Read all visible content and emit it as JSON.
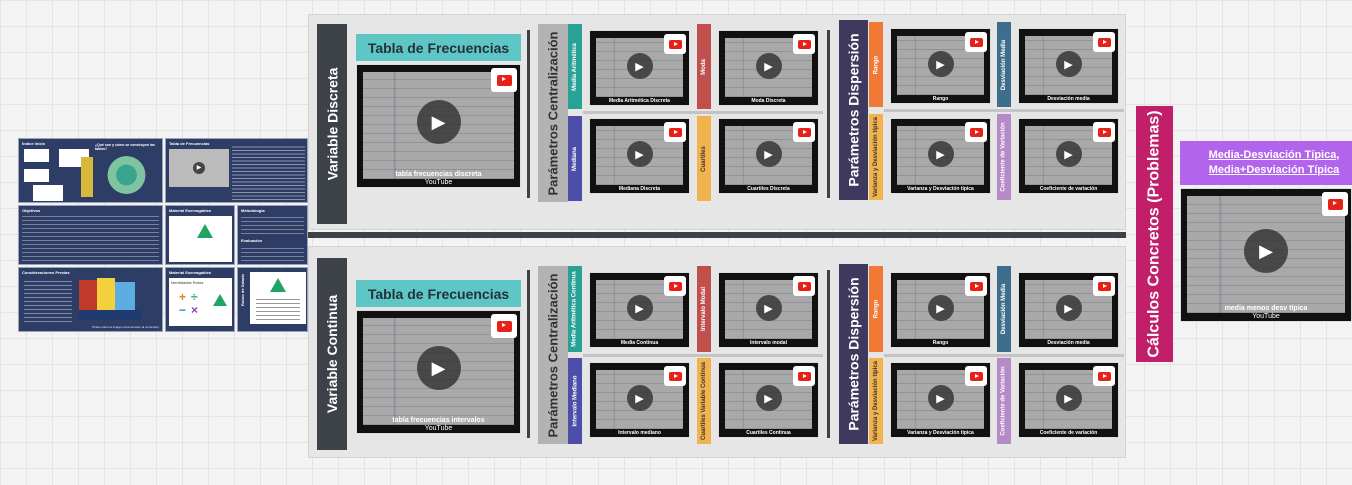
{
  "cards": {
    "intro_title": "Índice Inicio",
    "question_title": "¿Qué son y cómo se construyen las tablas?",
    "tabla_title": "Tabla de Frecuencias",
    "objetivos_title": "Objetivos",
    "material1_title": "Material Eservagables",
    "metodologia_title": "Metodología",
    "consideraciones_title": "Consideraciones Previas",
    "material2_title": "Material Eservagables",
    "evaluacion_title": "Evaluación",
    "identidades_label": "Identidades Rotos",
    "rubric_label": "Rubro de Salario",
    "footer_note": "(Pulse sobre la imagen para acceder al contenido)"
  },
  "discreta": {
    "section_label": "Variable Discreta",
    "tabla_title": "Tabla de Frecuencias",
    "tabla_video_caption": "tabla frecuencias discreta",
    "tabla_video_source": "YouTube",
    "centralizacion_label": "Parámetros Centralización",
    "dispersion_label": "Parámetros Dispersión",
    "tiles": [
      {
        "label": "Media Aritmética",
        "color": "#2aa196",
        "caption": "Media Aritmética Discreta"
      },
      {
        "label": "Moda",
        "color": "#c0504d",
        "caption": "Moda Discreta"
      },
      {
        "label": "Mediana",
        "color": "#4d4ea8",
        "caption": "Mediana Discreta"
      },
      {
        "label": "Cuartiles",
        "color": "#f2b24d",
        "caption": "Cuartiles Discreta"
      },
      {
        "label": "Rango",
        "color": "#f07a35",
        "caption": "Rango"
      },
      {
        "label": "Desviación Media",
        "color": "#3e6e8c",
        "caption": "Desviación media"
      },
      {
        "label": "Varianza y Desviación típica",
        "color": "#f2b24d",
        "caption": "Varianza y Desviación típica"
      },
      {
        "label": "Coeficiente de Variación",
        "color": "#b48ac7",
        "caption": "Coeficiente de variación"
      }
    ]
  },
  "continua": {
    "section_label": "Variable Continua",
    "tabla_title": "Tabla de Frecuencias",
    "tabla_video_caption": "tabla frecuencias intervalos",
    "tabla_video_source": "YouTube",
    "centralizacion_label": "Parámetros Centralización",
    "dispersion_label": "Parámetros Dispersión",
    "tiles": [
      {
        "label": "Media Aritmética Continua",
        "color": "#2aa196",
        "caption": "Media Continua"
      },
      {
        "label": "Intervalo Modal",
        "color": "#c0504d",
        "caption": "Intervalo modal"
      },
      {
        "label": "Intervalo Mediano",
        "color": "#4d4ea8",
        "caption": "Intervalo mediano"
      },
      {
        "label": "Cuartiles Variable Continua",
        "color": "#f2b24d",
        "caption": "Cuartiles Continua"
      },
      {
        "label": "Rango",
        "color": "#f07a35",
        "caption": "Rango"
      },
      {
        "label": "Desviación Media",
        "color": "#3e6e8c",
        "caption": "Desviación media"
      },
      {
        "label": "Varianza y Desviación típica",
        "color": "#f2b24d",
        "caption": "Varianza y Desviación típica"
      },
      {
        "label": "Coeficiente de Variación",
        "color": "#b48ac7",
        "caption": "Coeficiente de variación"
      }
    ]
  },
  "problemas": {
    "label": "Cálculos Concretos (Problemas)",
    "link_text": "Media-Desviación Típica, Media+Desviación Típica",
    "video_caption": "media menos desv típica",
    "video_source": "YouTube"
  },
  "colors": {
    "teal": "#5ec6c4",
    "pink": "#c21f6b",
    "purple": "#b264ec",
    "dark": "#3d4248"
  }
}
